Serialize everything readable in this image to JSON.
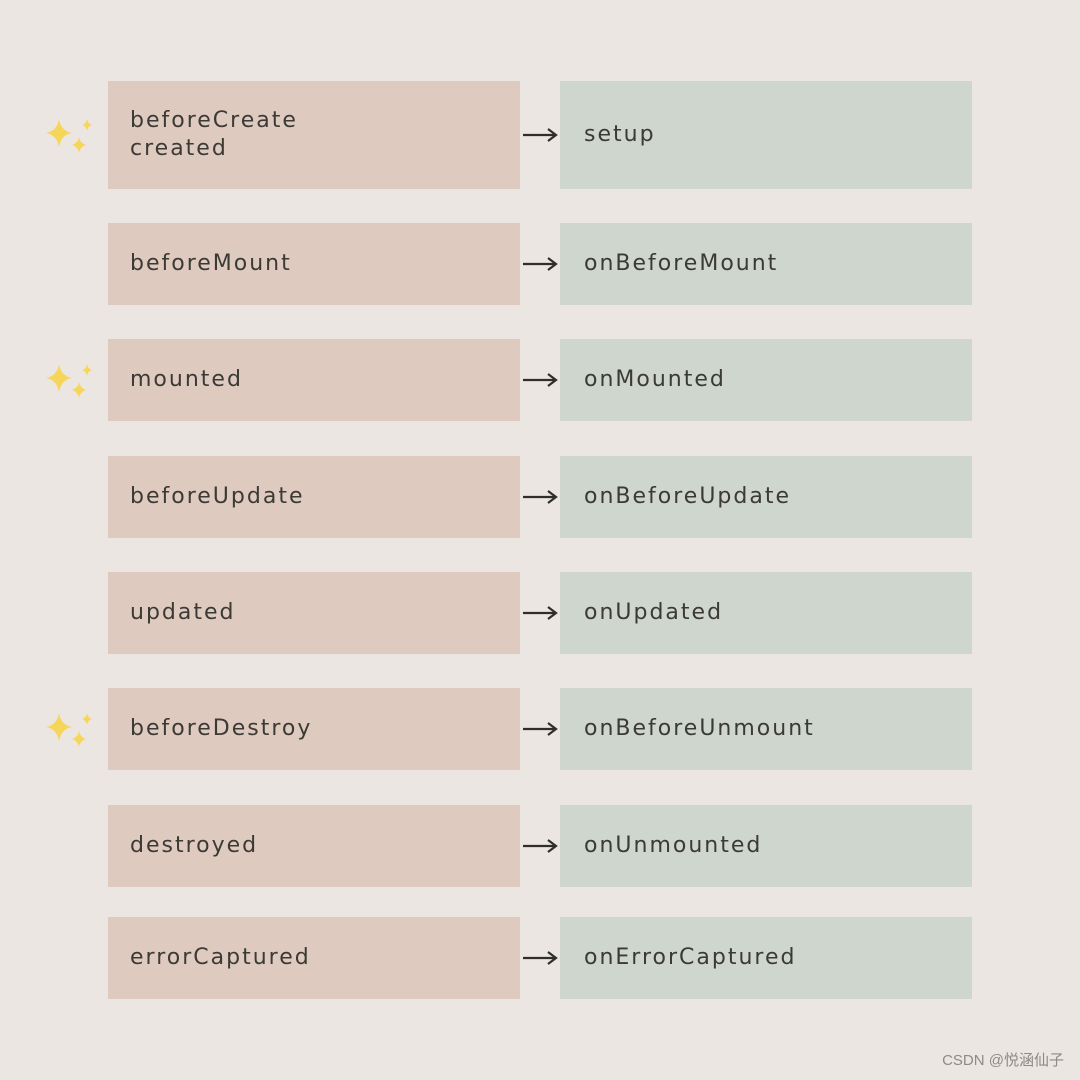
{
  "rows": [
    {
      "left": [
        "beforeCreate",
        "created"
      ],
      "right": "setup",
      "sparkle": true
    },
    {
      "left": [
        "beforeMount"
      ],
      "right": "onBeforeMount",
      "sparkle": false
    },
    {
      "left": [
        "mounted"
      ],
      "right": "onMounted",
      "sparkle": true
    },
    {
      "left": [
        "beforeUpdate"
      ],
      "right": "onBeforeUpdate",
      "sparkle": false
    },
    {
      "left": [
        "updated"
      ],
      "right": "onUpdated",
      "sparkle": false
    },
    {
      "left": [
        "beforeDestroy"
      ],
      "right": "onBeforeUnmount",
      "sparkle": true
    },
    {
      "left": [
        "destroyed"
      ],
      "right": "onUnmounted",
      "sparkle": false
    },
    {
      "left": [
        "errorCaptured"
      ],
      "right": "onErrorCaptured",
      "sparkle": false
    }
  ],
  "icons": {
    "sparkle": "sparkles-icon",
    "arrow": "arrow-right-icon"
  },
  "colors": {
    "background": "#ebe6e1",
    "left": "#dfcac0",
    "right": "#cfd6ce",
    "sparkle": "#f6d65a",
    "text": "#3b3a35"
  },
  "watermark": "CSDN @悦涵仙子"
}
